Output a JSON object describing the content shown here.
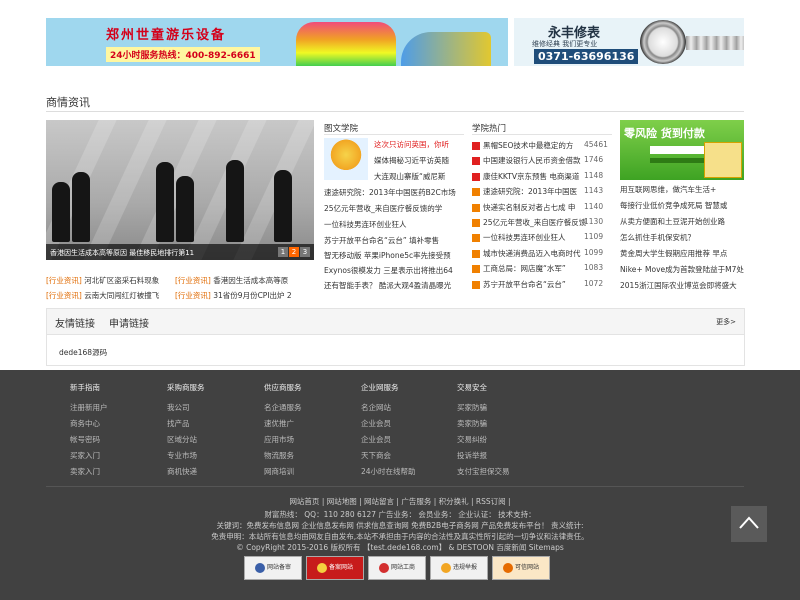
{
  "banners": {
    "left": {
      "title": "郑州世童游乐设备",
      "phone": "24小时服务热线：400-892-6661"
    },
    "right": {
      "title": "永丰修表",
      "sub": "维修经典  我们更专业",
      "phone": "0371-63696136"
    }
  },
  "section": {
    "title": "商情资讯"
  },
  "slideshow": {
    "caption": "香港因生活成本高等原因 最佳移民地排行第11",
    "pages": [
      "1",
      "2",
      "3"
    ]
  },
  "industry": {
    "tag": "[行业资讯]",
    "items": [
      "河北矿区盗采石料现象",
      "香港因生活成本高等原",
      "云南大同闯红灯被撞飞",
      "31省份9月份CPI出炉 2"
    ]
  },
  "tuwen": {
    "title": "图文学院",
    "items": [
      "这次只访问英国，你听",
      "媒体揭秘习近平访英随",
      "大连观山寨版“威尼斯",
      "速途研究院：2013年中国医药B2C市场",
      "25亿元年营收_来自医疗餐反馈的学",
      "一位科技男连环创业狂人",
      "苏宁开放平台命名“云台” 填补零售",
      "智无移动版 苹果iPhone5c率先接受预",
      "Exynos很模发力 三星表示出将推出64",
      "还有智能手表？ 酷派大观4盈清晶曝光"
    ]
  },
  "hot": {
    "title": "学院热门",
    "items": [
      {
        "text": "黑帽SEO技术中最稳定的方",
        "count": "45461"
      },
      {
        "text": "中国建设银行人民币资金借款",
        "count": "1746"
      },
      {
        "text": "康佳KKTV京东预售 电商渠道",
        "count": "1148"
      },
      {
        "text": "速途研究院：2013年中国医",
        "count": "1143"
      },
      {
        "text": "快递实名制反对者占七成 申",
        "count": "1140"
      },
      {
        "text": "25亿元年营收_来自医疗餐反馈",
        "count": "1130"
      },
      {
        "text": "一位科技男连环创业狂人",
        "count": "1109"
      },
      {
        "text": "城市快递消费品迈入电商时代",
        "count": "1099"
      },
      {
        "text": "工商总局：网店魔“水军”",
        "count": "1083"
      },
      {
        "text": "苏宁开放平台命名“云台”",
        "count": "1072"
      }
    ]
  },
  "right_ad": {
    "title": "零风险 货到付款"
  },
  "right_links": [
    "用互联网思维，做汽车生活+",
    "每接行业低价竞争成死局 智慧或",
    "从卖方便面和土豆泥开始创业路",
    "怎么抓住手机保安机？",
    "黄金周大学生假期应用推荐 早点",
    "Nike+ Move成为首款登陆益于M7处",
    "2015浙江国际农业博览会即将盛大"
  ],
  "friend": {
    "tab1": "友情链接",
    "tab2": "申请链接",
    "more": "更多>",
    "link": "dede168源码"
  },
  "footer": {
    "cols": [
      {
        "head": "新手指南",
        "items": [
          "注册新用户",
          "商务中心",
          "帐号密码",
          "买家入门",
          "卖家入门"
        ]
      },
      {
        "head": "采购商服务",
        "items": [
          "我公司",
          "找产品",
          "区域分站",
          "专业市场",
          "商机快递"
        ]
      },
      {
        "head": "供应商服务",
        "items": [
          "名企通服务",
          "速优推广",
          "应用市场",
          "物流服务",
          "网商培训"
        ]
      },
      {
        "head": "企业网服务",
        "items": [
          "名企网站",
          "企业会员",
          "企业会员",
          "天下商会",
          "24小时在线帮助"
        ]
      },
      {
        "head": "交易安全",
        "items": [
          "买家防骗",
          "卖家防骗",
          "交易纠纷",
          "投诉举报",
          "支付宝担保交易"
        ]
      }
    ],
    "links": "网站首页 | 网站地图 | 网站留言 | 广告服务 | 积分换礼 | RSS订阅 |",
    "contact": "财富热线：  QQ：110 280 6127  广告业务：  会员业务：  企业认证：  技术支持：",
    "keywords": "关键词：免费发布信息网 企业信息发布网 供求信息查询网 免费B2B电子商务网 产品免费发布平台！ 责义统计:",
    "disclaimer": "免责申明：本站所有信息均由网友自由发布,本站不承担由于内容的合法性及真实性所引起的一切争议和法律责任。",
    "copyright": "© CopyRight 2015-2016 版权所有 【test.dede168.com】 & DESTOON 百度新闻 Sitemaps",
    "badges": [
      "网站备审",
      "备案网站",
      "网站工商",
      "违规举报",
      "可信网站"
    ]
  },
  "colors": {
    "accent": "#e06a00",
    "footer_bg": "#414141",
    "hot_red": "#e02020",
    "hot_orange": "#f08000"
  }
}
